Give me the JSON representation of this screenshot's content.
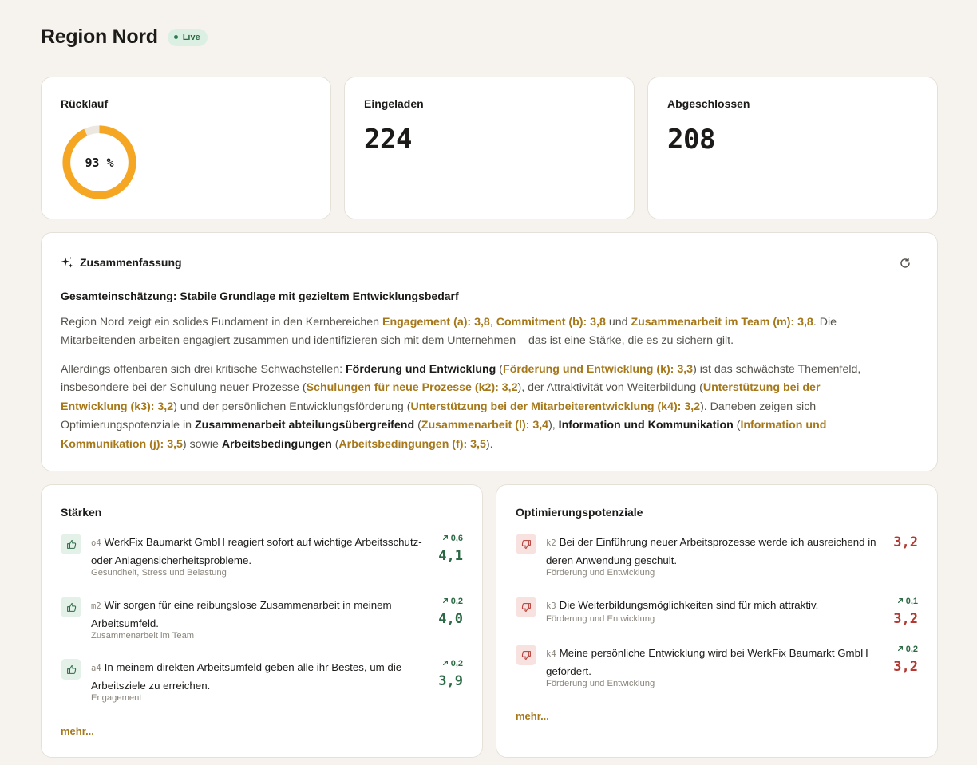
{
  "header": {
    "title": "Region Nord",
    "badge": "Live"
  },
  "kpis": {
    "ruecklauf": {
      "label": "Rücklauf",
      "value_text": "93 %",
      "percent": 93
    },
    "eingeladen": {
      "label": "Eingeladen",
      "value": "224"
    },
    "abgeschlossen": {
      "label": "Abgeschlossen",
      "value": "208"
    }
  },
  "summary": {
    "title": "Zusammenfassung",
    "subtitle": "Gesamteinschätzung: Stabile Grundlage mit gezieltem Entwicklungsbedarf",
    "p1": [
      {
        "t": "Region Nord zeigt ein solides Fundament in den Kernbereichen "
      },
      {
        "t": "Engagement (a): 3,8",
        "s": "hl"
      },
      {
        "t": ", "
      },
      {
        "t": "Commitment (b): 3,8",
        "s": "hl"
      },
      {
        "t": " und "
      },
      {
        "t": "Zusammenarbeit im Team (m): 3,8",
        "s": "hl"
      },
      {
        "t": ". Die Mitarbeitenden arbeiten engagiert zusammen und identifizieren sich mit dem Unternehmen – das ist eine Stärke, die es zu sichern gilt."
      }
    ],
    "p2": [
      {
        "t": "Allerdings offenbaren sich drei kritische Schwachstellen: "
      },
      {
        "t": "Förderung und Entwicklung",
        "s": "b"
      },
      {
        "t": " ("
      },
      {
        "t": "Förderung und Entwicklung (k): 3,3",
        "s": "hl"
      },
      {
        "t": ") ist das schwächste Themenfeld, insbesondere bei der Schulung neuer Prozesse ("
      },
      {
        "t": "Schulungen für neue Prozesse (k2): 3,2",
        "s": "hl"
      },
      {
        "t": "), der Attraktivität von Weiterbildung ("
      },
      {
        "t": "Unterstützung bei der Entwicklung (k3): 3,2",
        "s": "hl"
      },
      {
        "t": ") und der persönlichen Entwicklungsförderung ("
      },
      {
        "t": "Unterstützung bei der Mitarbeiterentwicklung (k4): 3,2",
        "s": "hl"
      },
      {
        "t": "). Daneben zeigen sich Optimierungspotenziale in "
      },
      {
        "t": "Zusammenarbeit abteilungsübergreifend",
        "s": "b"
      },
      {
        "t": " ("
      },
      {
        "t": "Zusammenarbeit (l): 3,4",
        "s": "hl"
      },
      {
        "t": "), "
      },
      {
        "t": "Information und Kommunikation",
        "s": "b"
      },
      {
        "t": " ("
      },
      {
        "t": "Information und Kommunikation (j): 3,5",
        "s": "hl"
      },
      {
        "t": ") sowie "
      },
      {
        "t": "Arbeitsbedingungen",
        "s": "b"
      },
      {
        "t": " ("
      },
      {
        "t": "Arbeitsbedingungen (f): 3,5",
        "s": "hl"
      },
      {
        "t": ")."
      }
    ]
  },
  "strengths": {
    "title": "Stärken",
    "more": "mehr...",
    "items": [
      {
        "code": "o4",
        "text": "WerkFix Baumarkt GmbH reagiert sofort auf wichtige Arbeitsschutz- oder Anlagensicherheitsprobleme.",
        "category": "Gesundheit, Stress und Belastung",
        "delta": "0,6",
        "score": "4,1"
      },
      {
        "code": "m2",
        "text": "Wir sorgen für eine reibungslose Zusammenarbeit in meinem Arbeitsumfeld.",
        "category": "Zusammenarbeit im Team",
        "delta": "0,2",
        "score": "4,0"
      },
      {
        "code": "a4",
        "text": "In meinem direkten Arbeitsumfeld geben alle ihr Bestes, um die Arbeitsziele zu erreichen.",
        "category": "Engagement",
        "delta": "0,2",
        "score": "3,9"
      }
    ]
  },
  "weaknesses": {
    "title": "Optimierungspotenziale",
    "more": "mehr...",
    "items": [
      {
        "code": "k2",
        "text": "Bei der Einführung neuer Arbeitsprozesse werde ich ausreichend in deren Anwendung geschult.",
        "category": "Förderung und Entwicklung",
        "delta": "",
        "score": "3,2"
      },
      {
        "code": "k3",
        "text": "Die Weiterbildungsmöglichkeiten sind für mich attraktiv.",
        "category": "Förderung und Entwicklung",
        "delta": "0,1",
        "score": "3,2"
      },
      {
        "code": "k4",
        "text": "Meine persönliche Entwicklung wird bei WerkFix Baumarkt GmbH gefördert.",
        "category": "Förderung und Entwicklung",
        "delta": "0,2",
        "score": "3,2"
      }
    ]
  },
  "colors": {
    "accent": "#f5a623",
    "track": "#ece8e0",
    "positive": "#2c6a45",
    "negative": "#b23a33",
    "highlight": "#a6781a"
  }
}
